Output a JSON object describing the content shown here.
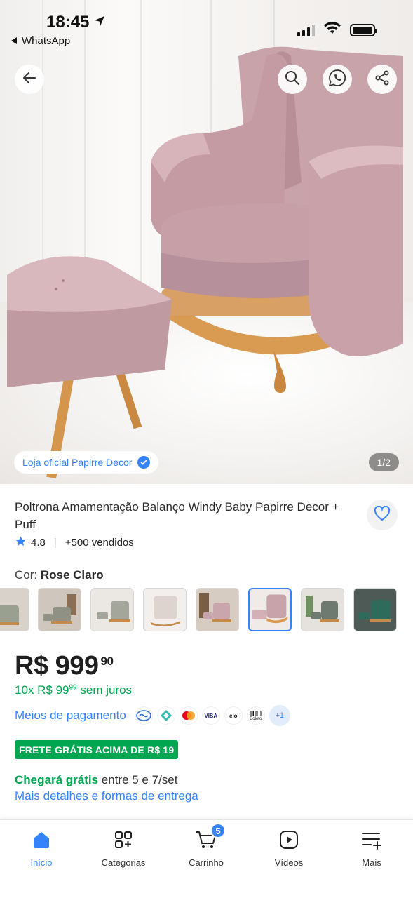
{
  "status_bar": {
    "time": "18:45",
    "back_app": "WhatsApp"
  },
  "gallery": {
    "store_label": "Loja oficial Papirre Decor",
    "counter": "1/2",
    "icons": [
      "back-arrow-icon",
      "search-icon",
      "whatsapp-icon",
      "share-icon"
    ]
  },
  "product": {
    "title": "Poltrona Amamentação Balanço Windy Baby Papirre Decor + Puff",
    "rating": "4.8",
    "sold": "+500 vendidos",
    "color_label": "Cor:",
    "color_value": "Rose Claro",
    "color_options_count": 8,
    "selected_color_index": 5,
    "price_main": "R$ 999",
    "price_cents": "90",
    "installment_prefix": "10x R$ 99",
    "installment_cents": "99",
    "installment_suffix": "sem juros",
    "payment_link": "Meios de pagamento",
    "payment_methods": [
      "mercado-pago-icon",
      "pix-icon",
      "mastercard-icon",
      "VISA",
      "elo",
      "Boleto"
    ],
    "payment_more": "+1",
    "free_shipping_badge": "FRETE GRÁTIS ACIMA DE R$ 19",
    "arrival_highlight": "Chegará grátis",
    "arrival_rest": "entre 5 e 7/set",
    "delivery_link": "Mais detalhes e formas de entrega"
  },
  "bottom_nav": {
    "items": [
      {
        "label": "Início",
        "icon": "home-icon",
        "active": true
      },
      {
        "label": "Categorias",
        "icon": "categories-icon",
        "active": false
      },
      {
        "label": "Carrinho",
        "icon": "cart-icon",
        "active": false,
        "badge": "5"
      },
      {
        "label": "Vídeos",
        "icon": "play-video-icon",
        "active": false
      },
      {
        "label": "Mais",
        "icon": "more-menu-icon",
        "active": false
      }
    ]
  },
  "colors": {
    "accent": "#3483fa",
    "success": "#00a650",
    "upholstery": "#c9a8ad",
    "wood": "#d99a52"
  }
}
